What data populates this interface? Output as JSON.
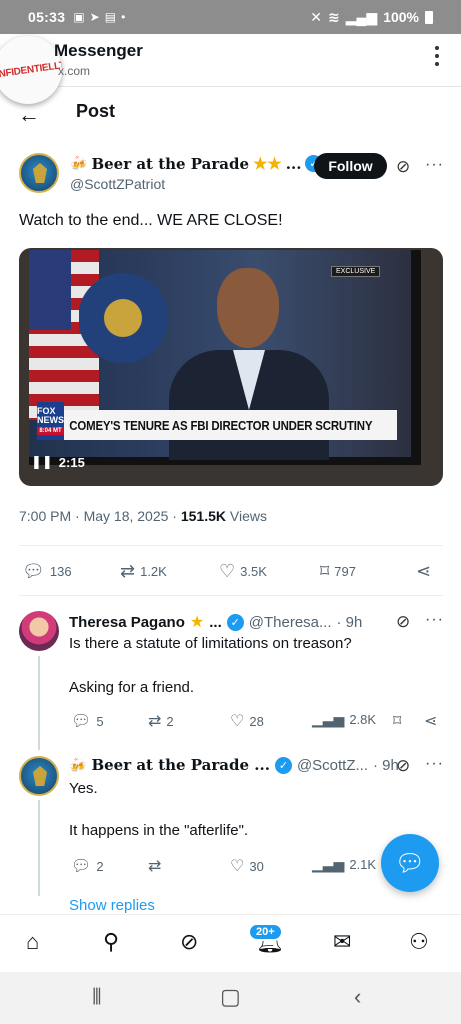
{
  "status_bar": {
    "time": "05:33",
    "battery": "100%"
  },
  "app_bar": {
    "badge": "ONFIDENTIELLT",
    "title": "Messenger",
    "url": "x.com"
  },
  "page": {
    "title": "Post"
  },
  "post": {
    "author_name": "Beer at the Parade",
    "author_stars": "★★",
    "author_trunc": "...",
    "handle": "@ScottZPatriot",
    "follow_label": "Follow",
    "text": "Watch to the end... WE ARE CLOSE!",
    "video": {
      "exclusive_tag": "EXCLUSIVE",
      "network": "FOX NEWS",
      "time_tag": "8:04 MT",
      "chyron": "COMEY'S TENURE AS FBI DIRECTOR UNDER SCRUTINY",
      "duration": "2:15"
    },
    "timestamp": "7:00 PM · May 18, 2025 · ",
    "views_count": "151.5K",
    "views_label": " Views",
    "stats": {
      "replies": "136",
      "reposts": "1.2K",
      "likes": "3.5K",
      "bookmarks": "797"
    }
  },
  "replies": [
    {
      "name": "Theresa Pagano",
      "star": "★",
      "trunc": "...",
      "handle": "@Theresa...",
      "time": "· 9h",
      "text1": "Is there a statute of limitations on treason?",
      "text2": "Asking for a friend.",
      "stats": {
        "replies": "5",
        "reposts": "2",
        "likes": "28",
        "views": "2.8K"
      }
    },
    {
      "name": "Beer at the Parade ...",
      "handle": "@ScottZ...",
      "time": "· 9h",
      "text1": "Yes.",
      "text2": "It happens in the \"afterlife\".",
      "stats": {
        "replies": "2",
        "reposts": "",
        "likes": "30",
        "views": "2.1K"
      }
    }
  ],
  "show_replies": "Show replies",
  "bottom_nav": {
    "notifications_badge": "20+"
  },
  "icons": {
    "reply": "speech-bubble",
    "repost": "repost-arrows",
    "like": "heart",
    "bookmark": "bookmark",
    "share": "share-nodes",
    "grok": "grok-slash-circle"
  },
  "colors": {
    "accent": "#1d9bf0",
    "text": "#0f1419",
    "muted": "#536471"
  }
}
